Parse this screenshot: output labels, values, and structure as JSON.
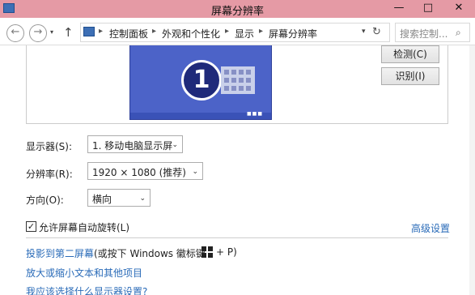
{
  "window": {
    "title": "屏幕分辨率",
    "controls": {
      "minimize": "—",
      "maximize": "□",
      "close": "✕"
    }
  },
  "address_bar": {
    "back_glyph": "←",
    "forward_glyph": "→",
    "dropdown_glyph": "▾",
    "up_glyph": "↑",
    "path_icon": "control-panel-icon",
    "separator": "▸",
    "breadcrumb": [
      "控制面板",
      "外观和个性化",
      "显示",
      "屏幕分辨率"
    ],
    "path_dropdown_glyph": "▾",
    "refresh_glyph": "↻",
    "search_placeholder": "搜索控制...",
    "search_glyph": "⌕"
  },
  "preview": {
    "monitor_number": "1",
    "detect_button": "检测(C)",
    "identify_button": "识别(I)",
    "taskbar_dots": "■■■"
  },
  "settings": {
    "display": {
      "label": "显示器(S):",
      "value": "1. 移动电脑显示屏",
      "arrow": "⌄"
    },
    "resolution": {
      "label": "分辨率(R):",
      "value": "1920 × 1080 (推荐)",
      "arrow": "⌄"
    },
    "orientation": {
      "label": "方向(O):",
      "value": "横向",
      "arrow": "⌄"
    }
  },
  "auto_rotate": {
    "checked": true,
    "check_glyph": "✓",
    "label": "允许屏幕自动旋转(L)"
  },
  "links": {
    "advanced": "高级设置",
    "project_link": "投影到第二屏幕",
    "project_hint": " (或按下 Windows 徽标键",
    "project_hint_end": "+ P)",
    "text_size": "放大或缩小文本和其他项目",
    "which_settings": "我应该选择什么显示器设置?"
  },
  "colors": {
    "titlebar": "#e59aa5",
    "monitor_blue": "#4c63c8",
    "link_blue": "#2a6bb8"
  }
}
